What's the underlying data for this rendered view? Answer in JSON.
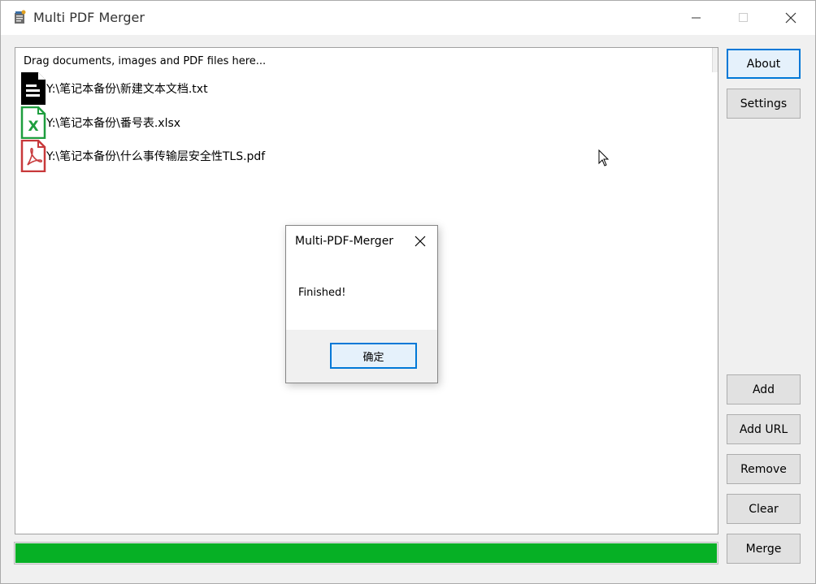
{
  "window": {
    "title": "Multi PDF Merger"
  },
  "file_list": {
    "hint": "Drag documents, images and PDF files here...",
    "items": [
      {
        "name": "Y:\\笔记本备份\\新建文本文档.txt",
        "icon": "txt-file-icon"
      },
      {
        "name": "Y:\\笔记本备份\\番号表.xlsx",
        "icon": "excel-file-icon"
      },
      {
        "name": "Y:\\笔记本备份\\什么事传输层安全性TLS.pdf",
        "icon": "pdf-file-icon"
      }
    ]
  },
  "side_buttons": {
    "about": "About",
    "settings": "Settings",
    "add": "Add",
    "add_url": "Add URL",
    "remove": "Remove",
    "clear": "Clear",
    "merge": "Merge"
  },
  "progress": {
    "value_percent": 100,
    "color": "#06b025"
  },
  "dialog": {
    "title": "Multi-PDF-Merger",
    "message": "Finished!",
    "ok_label": "确定"
  },
  "colors": {
    "accent": "#0078d7",
    "excel_green": "#1e9e3e",
    "pdf_red": "#c8393b"
  }
}
